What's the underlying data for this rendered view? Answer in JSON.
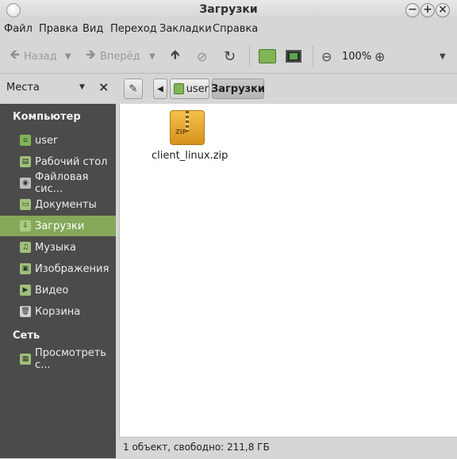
{
  "window": {
    "title": "Загрузки"
  },
  "menu": [
    "Файл",
    "Правка",
    "Вид",
    "Переход",
    "Закладки",
    "Справка"
  ],
  "toolbar": {
    "back": "Назад",
    "forward": "Вперёд",
    "zoom": "100%"
  },
  "sidebar_header": {
    "label": "Места"
  },
  "path": {
    "parent": "user",
    "current": "Загрузки"
  },
  "sidebar": {
    "computer": "Компьютер",
    "network": "Сеть",
    "items": [
      "user",
      "Рабочий стол",
      "Файловая сис...",
      "Документы",
      "Загрузки",
      "Музыка",
      "Изображения",
      "Видео",
      "Корзина"
    ],
    "network_items": [
      "Просмотреть с..."
    ]
  },
  "files": [
    {
      "name": "client_linux.zip",
      "type_label": "ZIP"
    }
  ],
  "status": "1 объект, свободно: 211,8 ГБ",
  "colors": {
    "accent": "#86a85a",
    "sidebar_bg": "#4b4b4b"
  }
}
